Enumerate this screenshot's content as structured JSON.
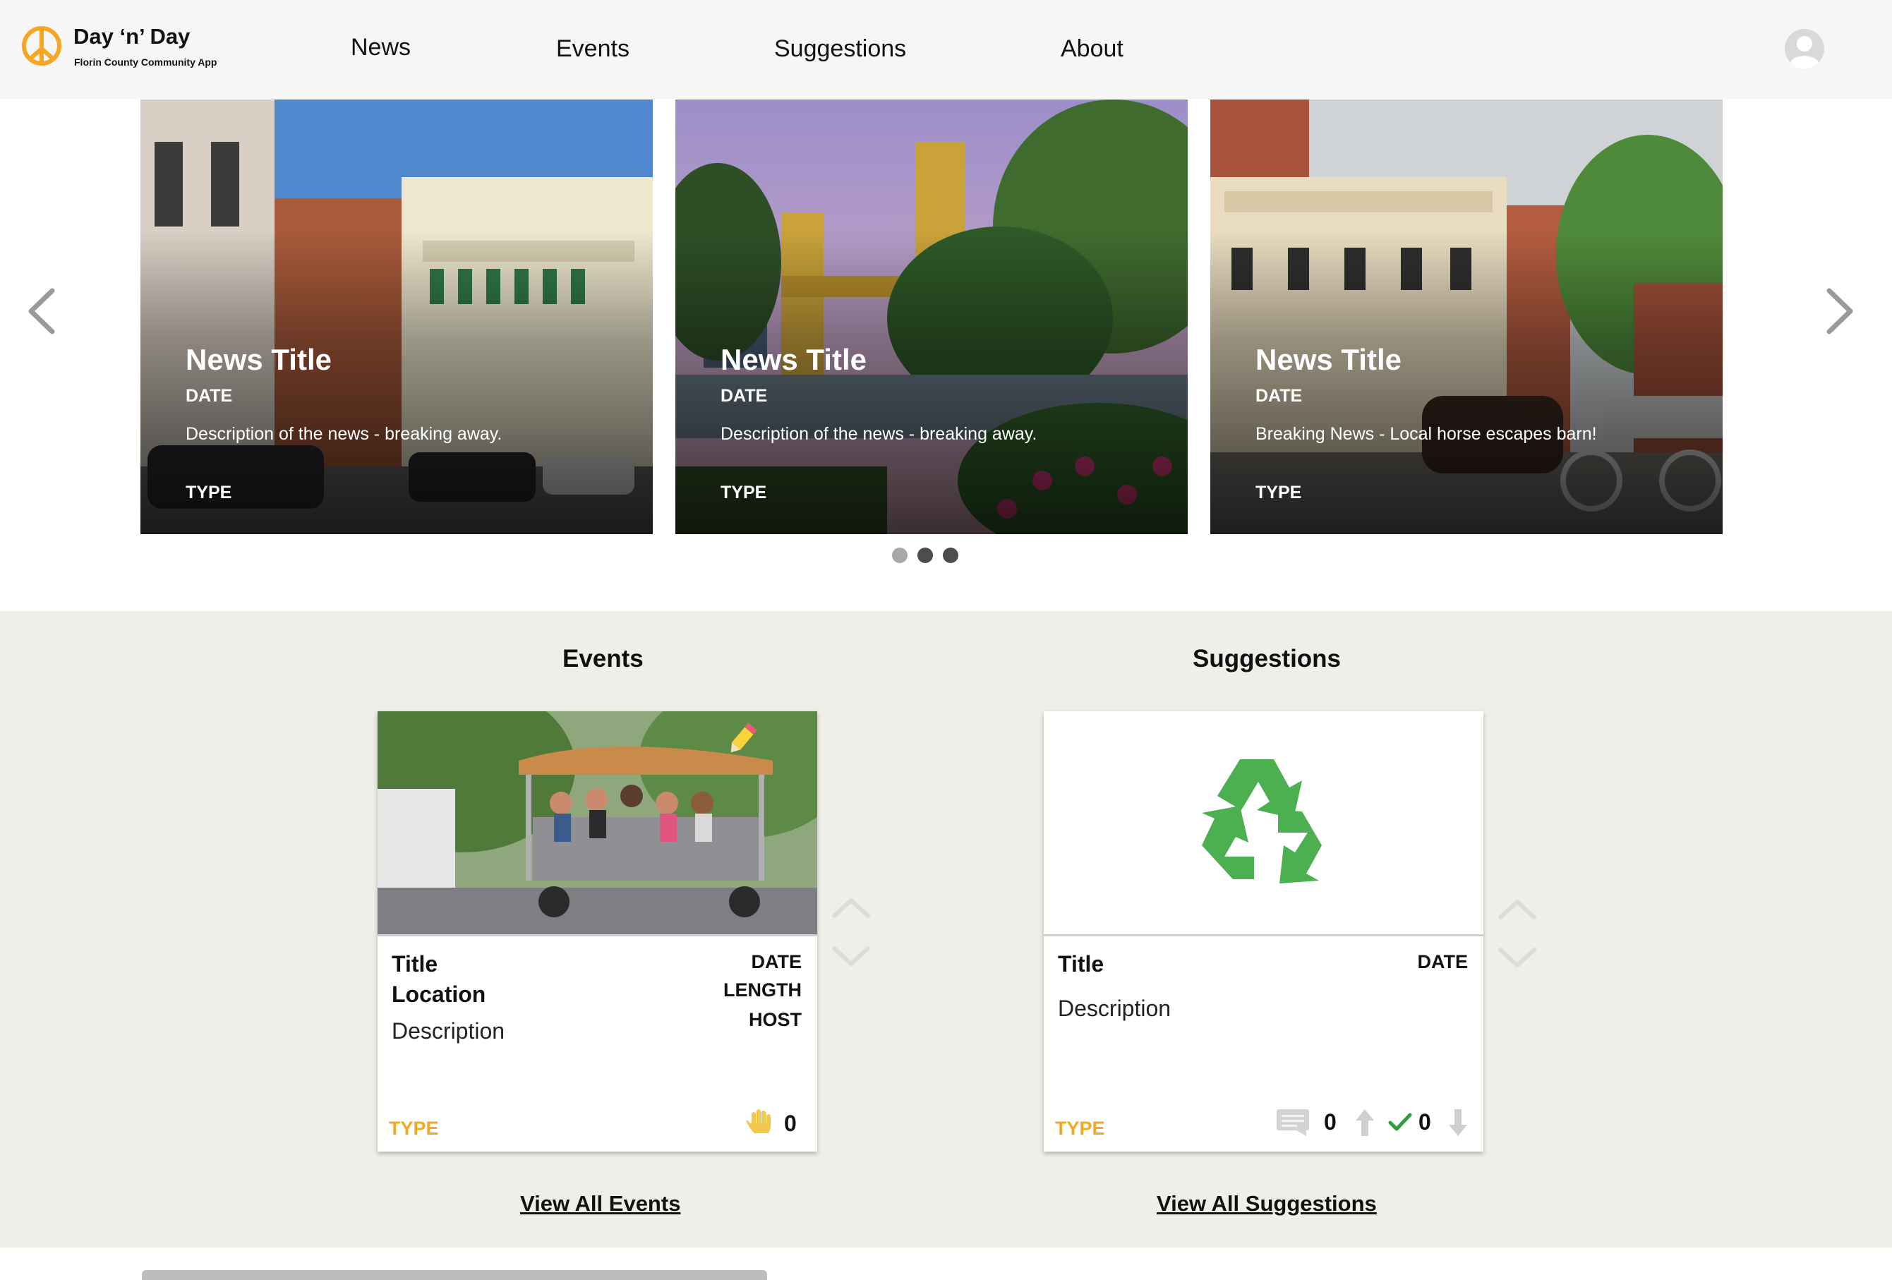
{
  "app": {
    "name": "Day ‘n’ Day",
    "subtitle": "Florin County Community App"
  },
  "nav": {
    "items": [
      "News",
      "Events",
      "Suggestions",
      "About"
    ]
  },
  "icons": {
    "logo": "peace-sign-icon",
    "account": "user-avatar-icon",
    "carousel_prev": "chevron-left-icon",
    "carousel_next": "chevron-right-icon",
    "edit": "pencil-icon",
    "attend": "raised-hand-icon",
    "comments": "comment-icon",
    "upvote": "arrow-up-icon",
    "approved": "checkmark-icon",
    "downvote": "arrow-down-icon",
    "suggestion_image": "recycle-icon"
  },
  "colors": {
    "header_bg": "#f6f6f6",
    "section_bg": "#efeee8",
    "accent_orange": "#f5a623",
    "recycle_green": "#4caf50",
    "check_green": "#2e9e3f"
  },
  "news": [
    {
      "title": "News Title",
      "date": "DATE",
      "description": "Description of the news - breaking away.",
      "type": "TYPE"
    },
    {
      "title": "News Title",
      "date": "DATE",
      "description": "Description of the news - breaking away.",
      "type": "TYPE"
    },
    {
      "title": "News Title",
      "date": "DATE",
      "description": "Breaking News - Local horse escapes barn!",
      "type": "TYPE"
    }
  ],
  "carousel": {
    "pages": 3,
    "active_page": 1
  },
  "events": {
    "heading": "Events",
    "card": {
      "title": "Title",
      "location": "Location",
      "description": "Description",
      "date": "DATE",
      "length": "LENGTH",
      "host": "HOST",
      "type": "TYPE",
      "attendees": "0"
    },
    "view_all": "View All Events"
  },
  "suggestions": {
    "heading": "Suggestions",
    "card": {
      "title": "Title",
      "date": "DATE",
      "description": "Description",
      "type": "TYPE",
      "comments": "0",
      "votes": "0"
    },
    "view_all": "View All Suggestions"
  }
}
